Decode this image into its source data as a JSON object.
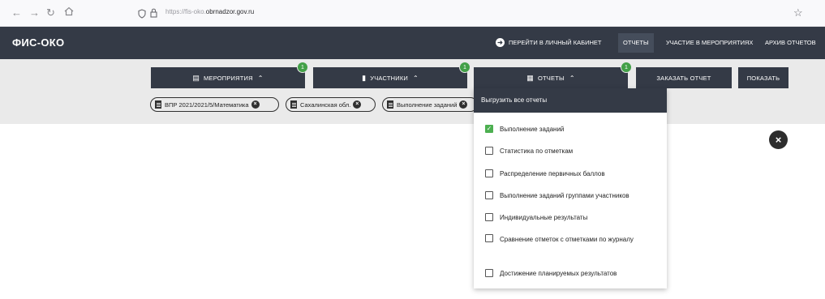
{
  "browser": {
    "url_prefix": "https://fis-oko.",
    "url_domain": "obrnadzor.gov.ru"
  },
  "app": {
    "title": "ФИС-ОКО",
    "nav": {
      "cabinet": "ПЕРЕЙТИ В ЛИЧНЫЙ КАБИНЕТ",
      "reports": "ОТЧЕТЫ",
      "participation": "УЧАСТИЕ В МЕРОПРИЯТИЯХ",
      "archive": "АРХИВ ОТЧЕТОВ"
    }
  },
  "filters": {
    "events": {
      "label": "МЕРОПРИЯТИЯ",
      "badge": "1"
    },
    "participants": {
      "label": "УЧАСТНИКИ",
      "badge": "1"
    },
    "reports": {
      "label": "ОТЧЕТЫ",
      "badge": "1"
    },
    "order_report": "ЗАКАЗАТЬ ОТЧЕТ",
    "show": "ПОКАЗАТЬ"
  },
  "chips": [
    {
      "label": "ВПР 2021/2021/5/Математика"
    },
    {
      "label": "Сахалинская обл."
    },
    {
      "label": "Выполнение заданий"
    }
  ],
  "menu": {
    "header": "Выгрузить все отчеты",
    "items": [
      {
        "label": "Выполнение заданий",
        "checked": true
      },
      {
        "label": "Статистика по отметкам",
        "checked": false
      },
      {
        "label": "Распределение первичных баллов",
        "checked": false
      },
      {
        "label": "Выполнение заданий группами участников",
        "checked": false
      },
      {
        "label": "Индивидуальные результаты",
        "checked": false
      },
      {
        "label": "Сравнение отметок с отметками по журналу",
        "checked": false
      },
      {
        "label": "Достижение планируемых результатов",
        "checked": false
      }
    ]
  },
  "colors": {
    "dark": "#343a46",
    "badge_green": "#43a047",
    "check_green": "#4caf50",
    "filter_bg": "#eaeaea"
  },
  "icons": {
    "back": "arrow-left-icon",
    "forward": "arrow-right-icon",
    "reload": "reload-icon",
    "home": "home-icon",
    "shield": "shield-icon",
    "lock": "lock-icon",
    "star": "star-icon",
    "close": "close-icon"
  }
}
